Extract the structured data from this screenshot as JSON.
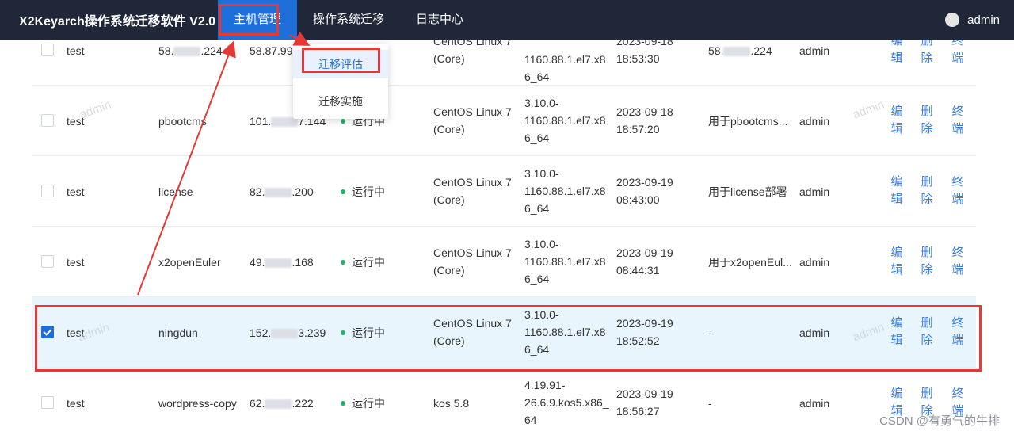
{
  "app": {
    "title": "X2Keyarch操作系统迁移软件 V2.0",
    "nav": [
      "主机管理",
      "操作系统迁移",
      "日志中心"
    ],
    "user": "admin"
  },
  "dropdown": {
    "items": [
      "迁移评估",
      "迁移实施"
    ]
  },
  "actions": {
    "edit": [
      "编",
      "辑"
    ],
    "delete": [
      "删",
      "除"
    ],
    "terminal": [
      "终",
      "端"
    ]
  },
  "watermark": "admin",
  "rows": [
    {
      "group": "test",
      "name": "",
      "ip_a": "58.",
      "ip_b": ".224",
      "ip2": "58.87.99.",
      "status": "",
      "os": [
        "CentOS Linux 7",
        "(Core)"
      ],
      "kernel": [
        "",
        "1160.88.1.el7.x8",
        "6_64"
      ],
      "time": [
        "2023-09-18",
        "18:53:30"
      ],
      "desc_a": "58.",
      "desc_b": ".224",
      "owner": "admin",
      "checked": false
    },
    {
      "group": "test",
      "name": "pbootcms",
      "ip_a": "101.",
      "ip_b": "7.144",
      "ip2": "",
      "status": "运行中",
      "os": [
        "CentOS Linux 7",
        "(Core)"
      ],
      "kernel": [
        "3.10.0-",
        "1160.88.1.el7.x8",
        "6_64"
      ],
      "time": [
        "2023-09-18",
        "18:57:20"
      ],
      "desc": "用于pbootcms...",
      "owner": "admin",
      "checked": false
    },
    {
      "group": "test",
      "name": "license",
      "ip_a": "82.",
      "ip_b": ".200",
      "ip2": "",
      "status": "运行中",
      "os": [
        "CentOS Linux 7",
        "(Core)"
      ],
      "kernel": [
        "3.10.0-",
        "1160.88.1.el7.x8",
        "6_64"
      ],
      "time": [
        "2023-09-19",
        "08:43:00"
      ],
      "desc": "用于license部署",
      "owner": "admin",
      "checked": false
    },
    {
      "group": "test",
      "name": "x2openEuler",
      "ip_a": "49.",
      "ip_b": ".168",
      "ip2": "",
      "status": "运行中",
      "os": [
        "CentOS Linux 7",
        "(Core)"
      ],
      "kernel": [
        "3.10.0-",
        "1160.88.1.el7.x8",
        "6_64"
      ],
      "time": [
        "2023-09-19",
        "08:44:31"
      ],
      "desc": "用于x2openEul...",
      "owner": "admin",
      "checked": false
    },
    {
      "group": "test",
      "name": "ningdun",
      "ip_a": "152.",
      "ip_b": "3.239",
      "ip2": "",
      "status": "运行中",
      "os": [
        "CentOS Linux 7",
        "(Core)"
      ],
      "kernel": [
        "3.10.0-",
        "1160.88.1.el7.x8",
        "6_64"
      ],
      "time": [
        "2023-09-19",
        "18:52:52"
      ],
      "desc": "-",
      "owner": "admin",
      "checked": true
    },
    {
      "group": "test",
      "name": "wordpress-copy",
      "ip_a": "62.",
      "ip_b": ".222",
      "ip2": "",
      "status": "运行中",
      "os": [
        "kos 5.8",
        ""
      ],
      "kernel": [
        "4.19.91-",
        "26.6.9.kos5.x86_",
        "64"
      ],
      "time": [
        "2023-09-19",
        "18:56:27"
      ],
      "desc": "-",
      "owner": "admin",
      "checked": false
    }
  ],
  "footer_watermark": "CSDN @有勇气的牛排",
  "colors": {
    "nav_bg": "#1f2738",
    "nav_active": "#1e6fd9",
    "link": "#3a7bd5",
    "status": "#21b36b",
    "highlight": "#e53935",
    "selected_row": "#e8f5fd"
  }
}
